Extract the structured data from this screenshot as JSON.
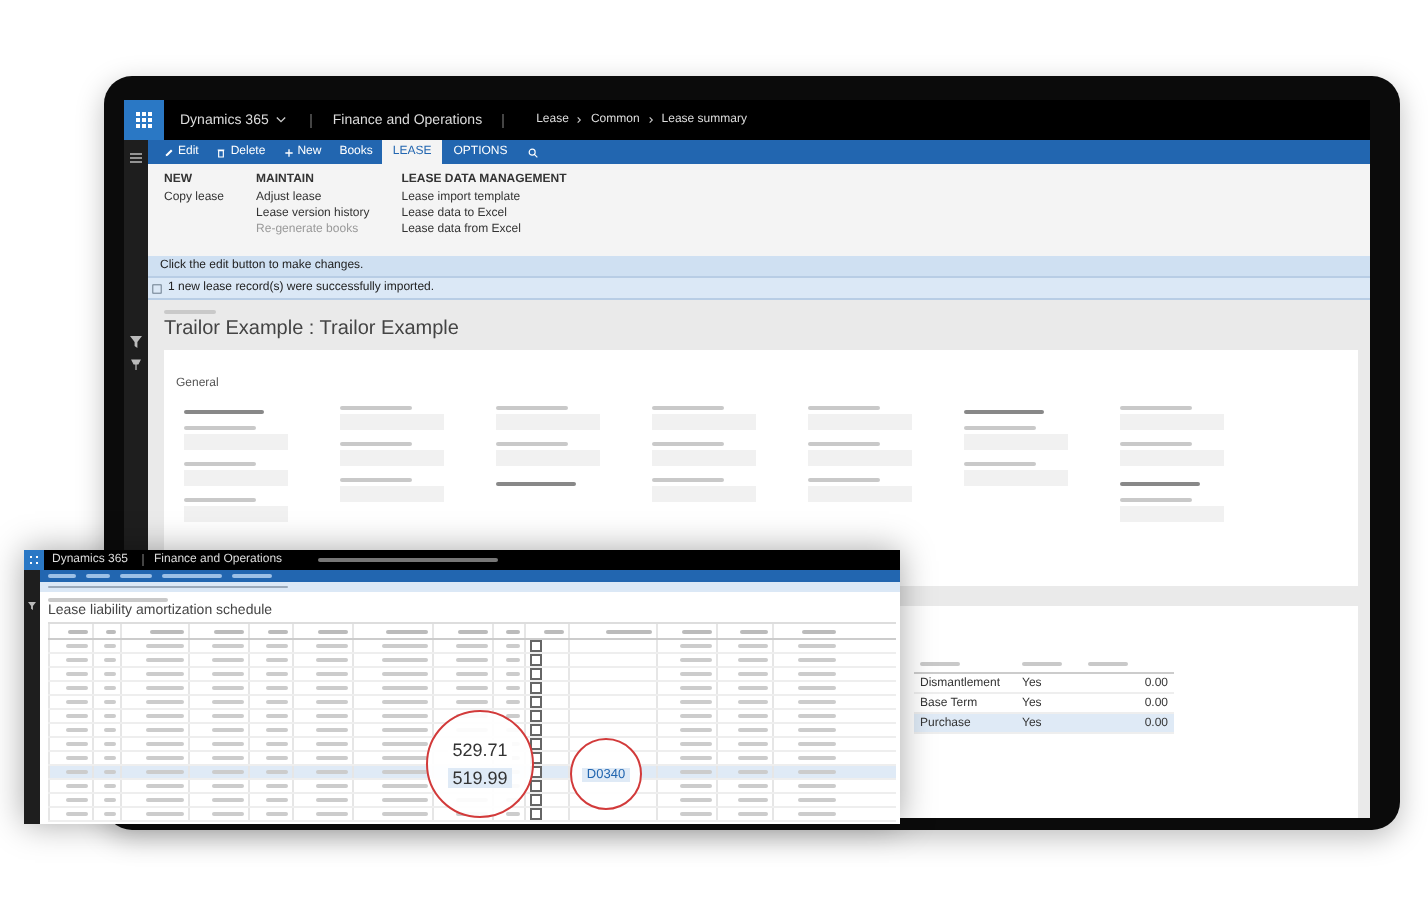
{
  "top_bar": {
    "app": "Dynamics 365",
    "module": "Finance and Operations",
    "breadcrumb": [
      "Lease",
      "Common",
      "Lease summary"
    ]
  },
  "actions": [
    {
      "label": "Edit"
    },
    {
      "label": "Delete"
    },
    {
      "label": "New"
    },
    {
      "label": "Books"
    }
  ],
  "tabs": [
    {
      "label": "LEASE",
      "selected": true
    },
    {
      "label": "OPTIONS",
      "selected": false
    }
  ],
  "ribbon_groups": [
    {
      "title": "NEW",
      "items": [
        {
          "label": "Copy lease",
          "disabled": false
        }
      ]
    },
    {
      "title": "MAINTAIN",
      "items": [
        {
          "label": "Adjust lease",
          "disabled": false
        },
        {
          "label": "Lease version history",
          "disabled": false
        },
        {
          "label": "Re-generate books",
          "disabled": true
        }
      ]
    },
    {
      "title": "LEASE DATA MANAGEMENT",
      "items": [
        {
          "label": "Lease import template",
          "disabled": false
        },
        {
          "label": "Lease data to Excel",
          "disabled": false
        },
        {
          "label": "Lease data from Excel",
          "disabled": false
        }
      ]
    }
  ],
  "messages": [
    {
      "kind": "info",
      "text": "Click the edit button to make changes."
    },
    {
      "kind": "success",
      "text": "1 new lease record(s) were successfully imported."
    }
  ],
  "header": {
    "title": "Trailor Example : Trailor Example"
  },
  "general": {
    "title": "General"
  },
  "options_grid": {
    "rows": [
      {
        "cells": [
          "Dismantlement",
          "Yes",
          "0.00"
        ],
        "selected": false
      },
      {
        "cells": [
          "Base Term",
          "Yes",
          "0.00"
        ],
        "selected": false
      },
      {
        "cells": [
          "Purchase",
          "Yes",
          "0.00"
        ],
        "selected": true
      }
    ]
  },
  "overlay": {
    "top_bar": {
      "app": "Dynamics 365",
      "module": "Finance and Operations"
    },
    "title": "Lease liability amortization schedule",
    "rows": [
      {
        "confirmed": false,
        "selected": false
      },
      {
        "confirmed": false,
        "selected": false
      },
      {
        "confirmed": false,
        "selected": false
      },
      {
        "confirmed": false,
        "selected": false
      },
      {
        "confirmed": false,
        "selected": false
      },
      {
        "confirmed": false,
        "selected": false
      },
      {
        "confirmed": false,
        "selected": false
      },
      {
        "confirmed": false,
        "selected": false
      },
      {
        "confirmed": false,
        "selected": false
      },
      {
        "confirmed": false,
        "selected": true
      },
      {
        "confirmed": false,
        "selected": false
      },
      {
        "confirmed": false,
        "selected": false
      },
      {
        "confirmed": false,
        "selected": false
      }
    ]
  },
  "callouts": [
    {
      "texts": [
        "529.71",
        "519.99"
      ]
    },
    {
      "texts": [
        "D0340"
      ]
    }
  ]
}
